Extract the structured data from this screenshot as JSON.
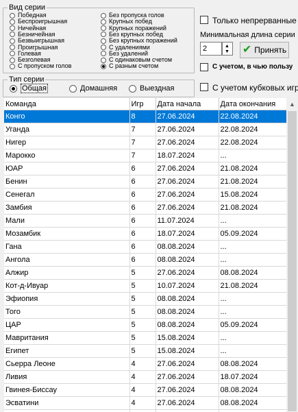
{
  "series_kind": {
    "caption": "Вид серии",
    "options_col1": [
      "Победная",
      "Беспроигрышная",
      "Ничейная",
      "Безничейная",
      "Безвыигрышная",
      "Проигрышная",
      "Голевая",
      "Безголевая",
      "С пропуском голов"
    ],
    "options_col2": [
      "Без пропуска голов",
      "Крупных побед",
      "Крупных поражений",
      "Без крупных побед",
      "Без крупных поражений",
      "С удалениями",
      "Без удалений",
      "С одинаковым счетом",
      "С разным счетом"
    ],
    "selected": "С разным счетом"
  },
  "options": {
    "continuous_label": "Только непрерванные",
    "continuous_checked": false,
    "min_length_label": "Минимальная длина серии",
    "min_length_value": "2",
    "accept_label": "Принять",
    "whose_favor_label": "С учетом, в чью пользу",
    "whose_favor_checked": false,
    "cup_label": "С учетом кубковых игр",
    "cup_checked": false
  },
  "series_type": {
    "caption": "Тип серии",
    "options": [
      "Общая",
      "Домашняя",
      "Выездная"
    ],
    "selected": "Общая"
  },
  "table": {
    "columns": [
      "Команда",
      "Игр",
      "Дата начала",
      "Дата окончания"
    ],
    "selected_row": 0,
    "rows": [
      [
        "Конго",
        "8",
        "27.06.2024",
        "22.08.2024"
      ],
      [
        "Уганда",
        "7",
        "27.06.2024",
        "22.08.2024"
      ],
      [
        "Нигер",
        "7",
        "27.06.2024",
        "22.08.2024"
      ],
      [
        "Марокко",
        "7",
        "18.07.2024",
        "..."
      ],
      [
        "ЮАР",
        "6",
        "27.06.2024",
        "21.08.2024"
      ],
      [
        "Бенин",
        "6",
        "27.06.2024",
        "21.08.2024"
      ],
      [
        "Сенегал",
        "6",
        "27.06.2024",
        "15.08.2024"
      ],
      [
        "Замбия",
        "6",
        "27.06.2024",
        "21.08.2024"
      ],
      [
        "Мали",
        "6",
        "11.07.2024",
        "..."
      ],
      [
        "Мозамбик",
        "6",
        "18.07.2024",
        "05.09.2024"
      ],
      [
        "Гана",
        "6",
        "08.08.2024",
        "..."
      ],
      [
        "Ангола",
        "6",
        "08.08.2024",
        "..."
      ],
      [
        "Алжир",
        "5",
        "27.06.2024",
        "08.08.2024"
      ],
      [
        "Кот-д-Ивуар",
        "5",
        "10.07.2024",
        "21.08.2024"
      ],
      [
        "Эфиопия",
        "5",
        "08.08.2024",
        "..."
      ],
      [
        "Того",
        "5",
        "08.08.2024",
        "..."
      ],
      [
        "ЦАР",
        "5",
        "08.08.2024",
        "05.09.2024"
      ],
      [
        "Мавритания",
        "5",
        "15.08.2024",
        "..."
      ],
      [
        "Египет",
        "5",
        "15.08.2024",
        "..."
      ],
      [
        "Сьерра Леоне",
        "4",
        "27.06.2024",
        "08.08.2024"
      ],
      [
        "Ливия",
        "4",
        "27.06.2024",
        "18.07.2024"
      ],
      [
        "Гвинея-Биссау",
        "4",
        "27.06.2024",
        "08.08.2024"
      ],
      [
        "Эсватини",
        "4",
        "27.06.2024",
        "08.08.2024"
      ],
      [
        "",
        "",
        "",
        ""
      ]
    ]
  }
}
